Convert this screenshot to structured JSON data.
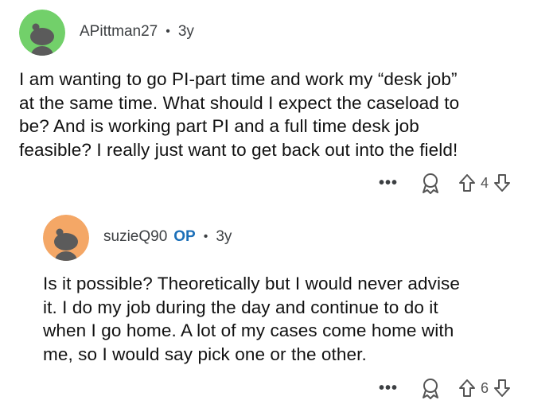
{
  "comments": [
    {
      "username": "APittman27",
      "separator": "•",
      "age": "3y",
      "is_op": false,
      "avatar_color": "#72d06a",
      "lines": [
        "I am wanting to go PI-part time and work my “desk job”",
        "at the same time. What should I expect the caseload to",
        "be? And is working part PI and a full time desk job",
        "feasible? I really just want to get back out into the field!"
      ],
      "more_label": "•••",
      "award_icon": "award-icon",
      "score": "4"
    },
    {
      "username": "suzieQ90",
      "op_badge": "OP",
      "separator": "•",
      "age": "3y",
      "is_op": true,
      "avatar_color": "#f4a766",
      "lines": [
        "Is it possible? Theoretically but I would never advise",
        "it. I do my job during the day and continue to do it",
        "when I go home. A lot of my cases come home with",
        "me, so I would say pick one or the other."
      ],
      "more_label": "•••",
      "award_icon": "award-icon",
      "score": "6"
    }
  ]
}
